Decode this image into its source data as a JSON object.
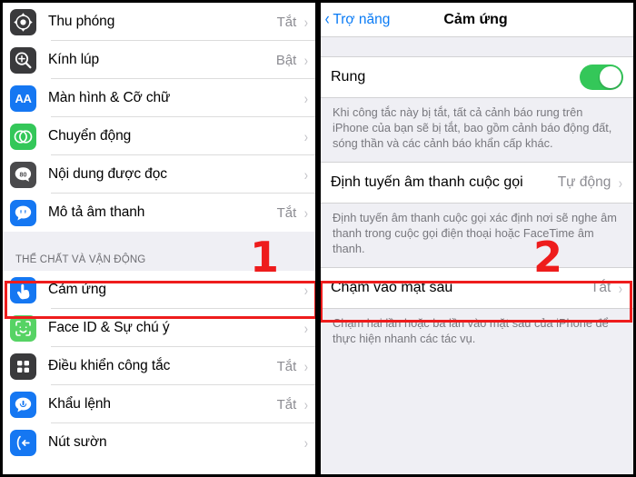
{
  "left_panel": {
    "rows_top": [
      {
        "label": "Thu phóng",
        "value": "Tắt",
        "icon": "zoom-icon",
        "icon_color": "#3a3a3c"
      },
      {
        "label": "Kính lúp",
        "value": "Bật",
        "icon": "magnifier-icon",
        "icon_color": "#3a3a3c"
      },
      {
        "label": "Màn hình & Cỡ chữ",
        "value": "",
        "icon": "display-text-icon",
        "icon_color": "#1577f2"
      },
      {
        "label": "Chuyển động",
        "value": "",
        "icon": "motion-icon",
        "icon_color": "#34c759"
      },
      {
        "label": "Nội dung được đọc",
        "value": "",
        "icon": "spoken-content-icon",
        "icon_color": "#4a4a4c"
      },
      {
        "label": "Mô tả âm thanh",
        "value": "Tắt",
        "icon": "audio-description-icon",
        "icon_color": "#1577f2"
      }
    ],
    "section_header": "THỂ CHẤT VÀ VẬN ĐỘNG",
    "rows_bottom": [
      {
        "label": "Cảm ứng",
        "value": "",
        "icon": "touch-icon",
        "icon_color": "#1577f2"
      },
      {
        "label": "Face ID & Sự chú ý",
        "value": "",
        "icon": "face-id-icon",
        "icon_color": "#56d364"
      },
      {
        "label": "Điều khiển công tắc",
        "value": "Tắt",
        "icon": "switch-control-icon",
        "icon_color": "#3a3a3c"
      },
      {
        "label": "Khẩu lệnh",
        "value": "Tắt",
        "icon": "voice-control-icon",
        "icon_color": "#1577f2"
      },
      {
        "label": "Nút sườn",
        "value": "",
        "icon": "side-button-icon",
        "icon_color": "#1577f2"
      }
    ]
  },
  "right_panel": {
    "nav": {
      "back_label": "Trợ năng",
      "title": "Cảm ứng"
    },
    "rows": [
      {
        "label": "Rung",
        "control": "toggle",
        "toggle_on": true,
        "note": "Khi công tắc này bị tắt, tất cả cảnh báo rung trên iPhone của bạn sẽ bị tắt, bao gồm cảnh báo động đất, sóng thần và các cảnh báo khẩn cấp khác."
      },
      {
        "label": "Định tuyến âm thanh cuộc gọi",
        "control": "value",
        "value": "Tự động",
        "note": "Định tuyến âm thanh cuộc gọi xác định nơi sẽ nghe âm thanh trong cuộc gọi điện thoại hoặc FaceTime âm thanh."
      },
      {
        "label": "Chạm vào mặt sau",
        "control": "value",
        "value": "Tắt",
        "note": "Chạm hai lần hoặc ba lần vào mặt sau của iPhone để thực hiện nhanh các tác vụ."
      }
    ]
  },
  "annotations": {
    "marker_one": "1",
    "marker_two": "2",
    "highlight_color": "#ee1c1c",
    "toggle_on_color": "#34c759",
    "accent_blue": "#0a7bf5"
  }
}
